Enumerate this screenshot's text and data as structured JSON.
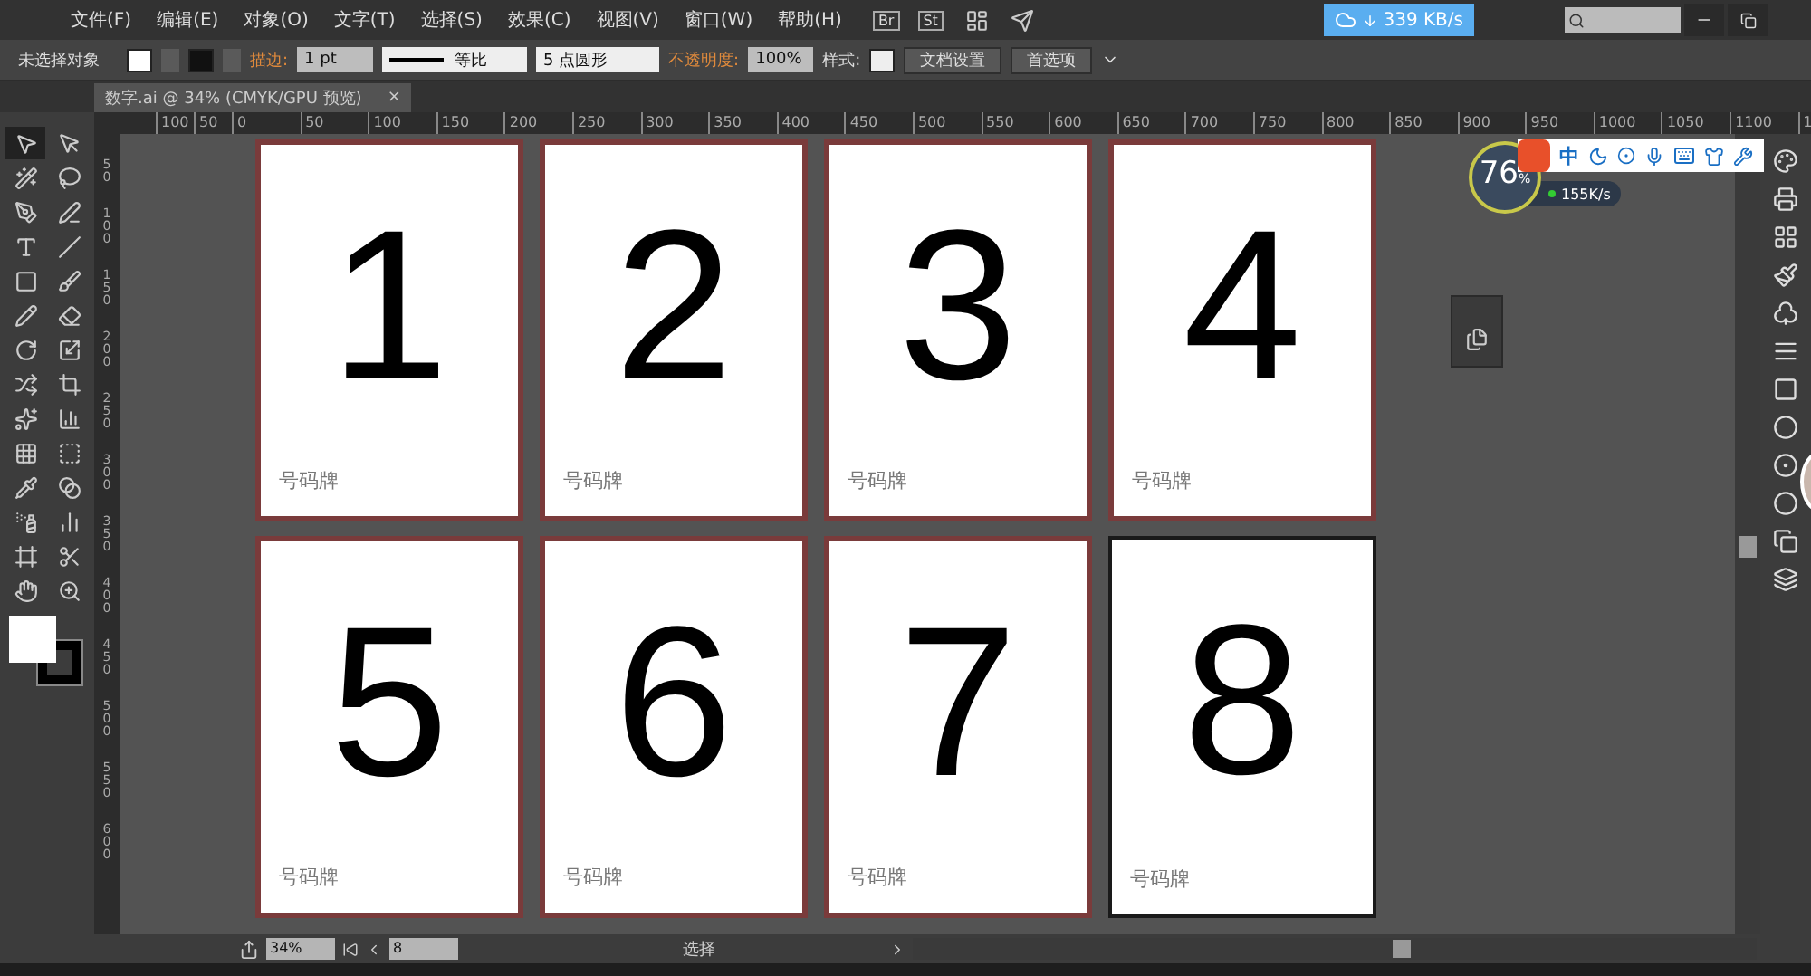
{
  "menu_bar": {
    "items": [
      "文件(F)",
      "编辑(E)",
      "对象(O)",
      "文字(T)",
      "选择(S)",
      "效果(C)",
      "视图(V)",
      "窗口(W)",
      "帮助(H)"
    ],
    "app_badges": [
      "Br",
      "St"
    ],
    "download_speed": "339 KB/s"
  },
  "control_bar": {
    "selection": "未选择对象",
    "stroke_label": "描边:",
    "stroke_weight": "1 pt",
    "stroke_profile": "等比",
    "brush": "5 点圆形",
    "opacity_label": "不透明度:",
    "opacity": "100%",
    "style_label": "样式:",
    "buttons": [
      "文档设置",
      "首选项"
    ]
  },
  "document_tab": {
    "title": "数字.ai @ 34% (CMYK/GPU 预览)",
    "close": "×"
  },
  "ruler": {
    "horizontal": [
      "100",
      "50",
      "0",
      "50",
      "100",
      "150",
      "200",
      "250",
      "300",
      "350",
      "400",
      "450",
      "500",
      "550",
      "600",
      "650",
      "700",
      "750",
      "800",
      "850",
      "900",
      "950",
      "1000",
      "1050",
      "1100",
      "1"
    ],
    "vertical": [
      "50",
      "100",
      "150",
      "200",
      "250",
      "300",
      "350",
      "400",
      "450",
      "500",
      "550",
      "600"
    ]
  },
  "tools": [
    {
      "selected": true
    },
    {
      "selected": false
    },
    {
      "selected": false
    },
    {
      "selected": false
    },
    {
      "selected": false
    },
    {
      "selected": false
    },
    {
      "selected": false
    },
    {
      "selected": false
    },
    {
      "selected": false
    },
    {
      "selected": false
    },
    {
      "selected": false
    },
    {
      "selected": false
    },
    {
      "selected": false
    },
    {
      "selected": false
    },
    {
      "selected": false
    },
    {
      "selected": false
    },
    {
      "selected": false
    },
    {
      "selected": false
    },
    {
      "selected": false
    },
    {
      "selected": false
    },
    {
      "selected": false
    },
    {
      "selected": false
    },
    {
      "selected": false
    },
    {
      "selected": false
    },
    {
      "selected": false
    },
    {
      "selected": false
    },
    {
      "selected": false
    },
    {
      "selected": false
    }
  ],
  "artboards": [
    {
      "number": "1",
      "label": "号码牌",
      "selected": false
    },
    {
      "number": "2",
      "label": "号码牌",
      "selected": false
    },
    {
      "number": "3",
      "label": "号码牌",
      "selected": false
    },
    {
      "number": "4",
      "label": "号码牌",
      "selected": false
    },
    {
      "number": "5",
      "label": "号码牌",
      "selected": false
    },
    {
      "number": "6",
      "label": "号码牌",
      "selected": false
    },
    {
      "number": "7",
      "label": "号码牌",
      "selected": false
    },
    {
      "number": "8",
      "label": "号码牌",
      "selected": true
    }
  ],
  "system_monitor": {
    "percent": "76",
    "unit": "%",
    "speed": "155K/s"
  },
  "input_method_bar": {
    "mode": "中"
  },
  "status_bar": {
    "zoom": "34%",
    "artboard": "8",
    "tool": "选择"
  }
}
